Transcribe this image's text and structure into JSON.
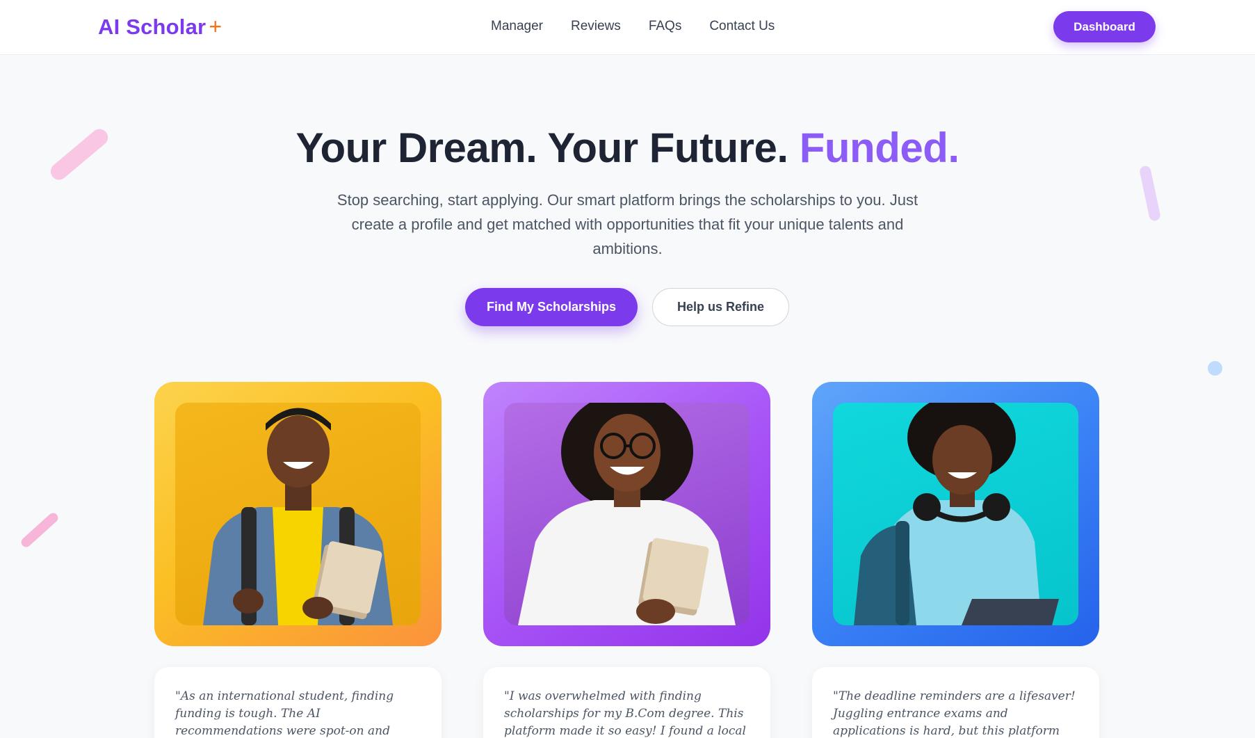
{
  "brand": {
    "name": "AI Scholar",
    "plus": "+"
  },
  "nav": {
    "links": [
      {
        "label": "Manager"
      },
      {
        "label": "Reviews"
      },
      {
        "label": "FAQs"
      },
      {
        "label": "Contact Us"
      }
    ],
    "dashboard_label": "Dashboard"
  },
  "hero": {
    "title_main": "Your Dream. Your Future.",
    "title_accent": "Funded.",
    "subtitle": "Stop searching, start applying. Our smart platform brings the scholarships to you. Just create a profile and get matched with opportunities that fit your unique talents and ambitions.",
    "primary_cta": "Find My Scholarships",
    "secondary_cta": "Help us Refine"
  },
  "testimonials": [
    {
      "quote": "\"As an international student, finding funding is tough. The AI recommendations were spot-on and helped me find scholarships to study"
    },
    {
      "quote": "\"I was overwhelmed with finding scholarships for my B.Com degree. This platform made it so easy! I found a local scholarship I never would"
    },
    {
      "quote": "\"The deadline reminders are a lifesaver! Juggling entrance exams and applications is hard, but this platform kept me on track. I"
    }
  ],
  "colors": {
    "brand_purple": "#7c3aed",
    "accent_orange": "#f97316",
    "card_yellow": "#fbbf24",
    "card_purple": "#a855f7",
    "card_blue": "#3b82f6"
  }
}
